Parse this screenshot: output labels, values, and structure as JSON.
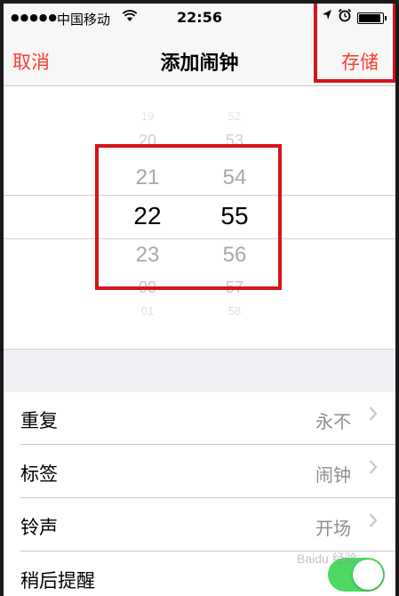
{
  "status_bar": {
    "signal": "●●●●●",
    "carrier": "中国移动",
    "time": "22:56"
  },
  "nav": {
    "cancel_label": "取消",
    "title": "添加闹钟",
    "save_label": "存储"
  },
  "picker": {
    "hours": [
      "19",
      "20",
      "21",
      "22",
      "23",
      "00",
      "01"
    ],
    "minutes": [
      "52",
      "53",
      "54",
      "55",
      "56",
      "57",
      "58"
    ],
    "selected_hour": "22",
    "selected_minute": "55"
  },
  "settings": {
    "repeat": {
      "label": "重复",
      "value": "永不"
    },
    "tag": {
      "label": "标签",
      "value": "闹钟"
    },
    "sound": {
      "label": "铃声",
      "value": "开场"
    },
    "snooze": {
      "label": "稍后提醒",
      "enabled": true
    }
  },
  "watermark": {
    "text": "Baidu 经验"
  },
  "colors": {
    "accent": "#ff3b30",
    "highlight_box": "#d5141d",
    "toggle_on": "#4cd964"
  }
}
